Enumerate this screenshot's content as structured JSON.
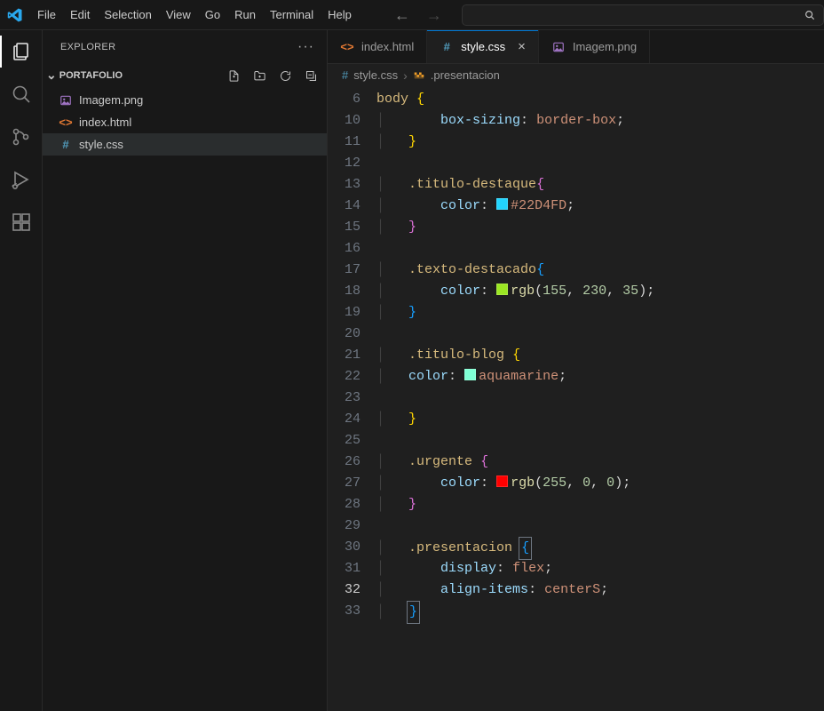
{
  "menus": [
    "File",
    "Edit",
    "Selection",
    "View",
    "Go",
    "Run",
    "Terminal",
    "Help"
  ],
  "sidebar": {
    "title": "EXPLORER",
    "folder": "PORTAFOLIO",
    "items": [
      {
        "icon": "image",
        "iconColor": "#a074c4",
        "label": "Imagem.png"
      },
      {
        "icon": "html",
        "iconColor": "#e37933",
        "label": "index.html"
      },
      {
        "icon": "css",
        "iconColor": "#519aba",
        "label": "style.css",
        "selected": true
      }
    ]
  },
  "tabs": [
    {
      "icon": "html",
      "iconColor": "#e37933",
      "label": "index.html",
      "active": false,
      "close": false
    },
    {
      "icon": "css",
      "iconColor": "#519aba",
      "label": "style.css",
      "active": true,
      "close": true
    },
    {
      "icon": "image",
      "iconColor": "#a074c4",
      "label": "Imagem.png",
      "active": false,
      "close": false
    }
  ],
  "breadcrumb": {
    "file": "style.css",
    "symbol": ".presentacion"
  },
  "colors": {
    "tituloDestaque": "#22D4FD",
    "textoDestacado": "rgb(155,230,35)",
    "tituloBlog": "#7fffd4",
    "urgente": "rgb(255,0,0)"
  },
  "code": {
    "startLine": 6,
    "lines": [
      {
        "n": 6,
        "segs": [
          {
            "cls": "tok-selector",
            "t": "body"
          },
          {
            "plain": " "
          },
          {
            "cls": "tok-punc",
            "t": "{"
          }
        ]
      },
      {
        "n": 10,
        "segs": [
          {
            "ind": 2
          },
          {
            "cls": "tok-prop",
            "t": "box-sizing"
          },
          {
            "cls": "tok-colon",
            "t": ":"
          },
          {
            "plain": " "
          },
          {
            "cls": "tok-val",
            "t": "border-box"
          },
          {
            "plain": ";"
          }
        ]
      },
      {
        "n": 11,
        "segs": [
          {
            "ind": 1
          },
          {
            "cls": "tok-punc",
            "t": "}"
          }
        ]
      },
      {
        "n": 12,
        "segs": []
      },
      {
        "n": 13,
        "segs": [
          {
            "ind": 1
          },
          {
            "cls": "tok-selector",
            "t": ".titulo-destaque"
          },
          {
            "cls": "tok-brace-o",
            "t": "{"
          }
        ]
      },
      {
        "n": 14,
        "segs": [
          {
            "ind": 2
          },
          {
            "cls": "tok-prop",
            "t": "color"
          },
          {
            "cls": "tok-colon",
            "t": ":"
          },
          {
            "plain": " "
          },
          {
            "swatch": "tituloDestaque"
          },
          {
            "cls": "tok-val",
            "t": "#22D4FD"
          },
          {
            "plain": ";"
          }
        ]
      },
      {
        "n": 15,
        "segs": [
          {
            "ind": 1
          },
          {
            "cls": "tok-brace-o",
            "t": "}"
          }
        ]
      },
      {
        "n": 16,
        "segs": []
      },
      {
        "n": 17,
        "segs": [
          {
            "ind": 1
          },
          {
            "cls": "tok-selector",
            "t": ".texto-destacado"
          },
          {
            "cls": "tok-brace-b",
            "t": "{"
          }
        ]
      },
      {
        "n": 18,
        "segs": [
          {
            "ind": 2
          },
          {
            "cls": "tok-prop",
            "t": "color"
          },
          {
            "cls": "tok-colon",
            "t": ":"
          },
          {
            "plain": " "
          },
          {
            "swatch": "textoDestacado"
          },
          {
            "cls": "tok-func",
            "t": "rgb"
          },
          {
            "plain": "("
          },
          {
            "cls": "tok-num",
            "t": "155"
          },
          {
            "plain": ", "
          },
          {
            "cls": "tok-num",
            "t": "230"
          },
          {
            "plain": ", "
          },
          {
            "cls": "tok-num",
            "t": "35"
          },
          {
            "plain": ");"
          }
        ]
      },
      {
        "n": 19,
        "segs": [
          {
            "ind": 1
          },
          {
            "cls": "tok-brace-b",
            "t": "}"
          }
        ]
      },
      {
        "n": 20,
        "segs": []
      },
      {
        "n": 21,
        "segs": [
          {
            "ind": 1
          },
          {
            "cls": "tok-selector",
            "t": ".titulo-blog"
          },
          {
            "plain": " "
          },
          {
            "cls": "tok-punc",
            "t": "{"
          }
        ]
      },
      {
        "n": 22,
        "segs": [
          {
            "ind": 1
          },
          {
            "cls": "tok-prop",
            "t": "color"
          },
          {
            "cls": "tok-colon",
            "t": ":"
          },
          {
            "plain": " "
          },
          {
            "swatch": "tituloBlog"
          },
          {
            "cls": "tok-val",
            "t": "aquamarine"
          },
          {
            "plain": ";"
          }
        ]
      },
      {
        "n": 23,
        "segs": []
      },
      {
        "n": 24,
        "segs": [
          {
            "ind": 1
          },
          {
            "cls": "tok-punc",
            "t": "}"
          }
        ]
      },
      {
        "n": 25,
        "segs": []
      },
      {
        "n": 26,
        "segs": [
          {
            "ind": 1
          },
          {
            "cls": "tok-selector",
            "t": ".urgente"
          },
          {
            "plain": " "
          },
          {
            "cls": "tok-brace-o",
            "t": "{"
          }
        ]
      },
      {
        "n": 27,
        "segs": [
          {
            "ind": 2
          },
          {
            "cls": "tok-prop",
            "t": "color"
          },
          {
            "cls": "tok-colon",
            "t": ":"
          },
          {
            "plain": " "
          },
          {
            "swatch": "urgente"
          },
          {
            "cls": "tok-func",
            "t": "rgb"
          },
          {
            "plain": "("
          },
          {
            "cls": "tok-num",
            "t": "255"
          },
          {
            "plain": ", "
          },
          {
            "cls": "tok-num",
            "t": "0"
          },
          {
            "plain": ", "
          },
          {
            "cls": "tok-num",
            "t": "0"
          },
          {
            "plain": ");"
          }
        ]
      },
      {
        "n": 28,
        "segs": [
          {
            "ind": 1
          },
          {
            "cls": "tok-brace-o",
            "t": "}"
          }
        ]
      },
      {
        "n": 29,
        "segs": []
      },
      {
        "n": 30,
        "segs": [
          {
            "ind": 1
          },
          {
            "cls": "tok-selector",
            "t": ".presentacion"
          },
          {
            "plain": " "
          },
          {
            "boxed": "{",
            "cls": "tok-brace-b"
          }
        ]
      },
      {
        "n": 31,
        "segs": [
          {
            "ind": 2
          },
          {
            "cls": "tok-prop",
            "t": "display"
          },
          {
            "cls": "tok-colon",
            "t": ":"
          },
          {
            "plain": " "
          },
          {
            "cls": "tok-val",
            "t": "flex"
          },
          {
            "plain": ";"
          }
        ]
      },
      {
        "n": 32,
        "current": true,
        "segs": [
          {
            "ind": 2
          },
          {
            "cls": "tok-prop",
            "t": "align-items"
          },
          {
            "cls": "tok-colon",
            "t": ":"
          },
          {
            "plain": " "
          },
          {
            "cls": "tok-val",
            "t": "centerS"
          },
          {
            "plain": ";"
          }
        ]
      },
      {
        "n": 33,
        "segs": [
          {
            "ind": 1
          },
          {
            "boxed": "}",
            "cls": "tok-brace-b"
          }
        ]
      }
    ]
  }
}
